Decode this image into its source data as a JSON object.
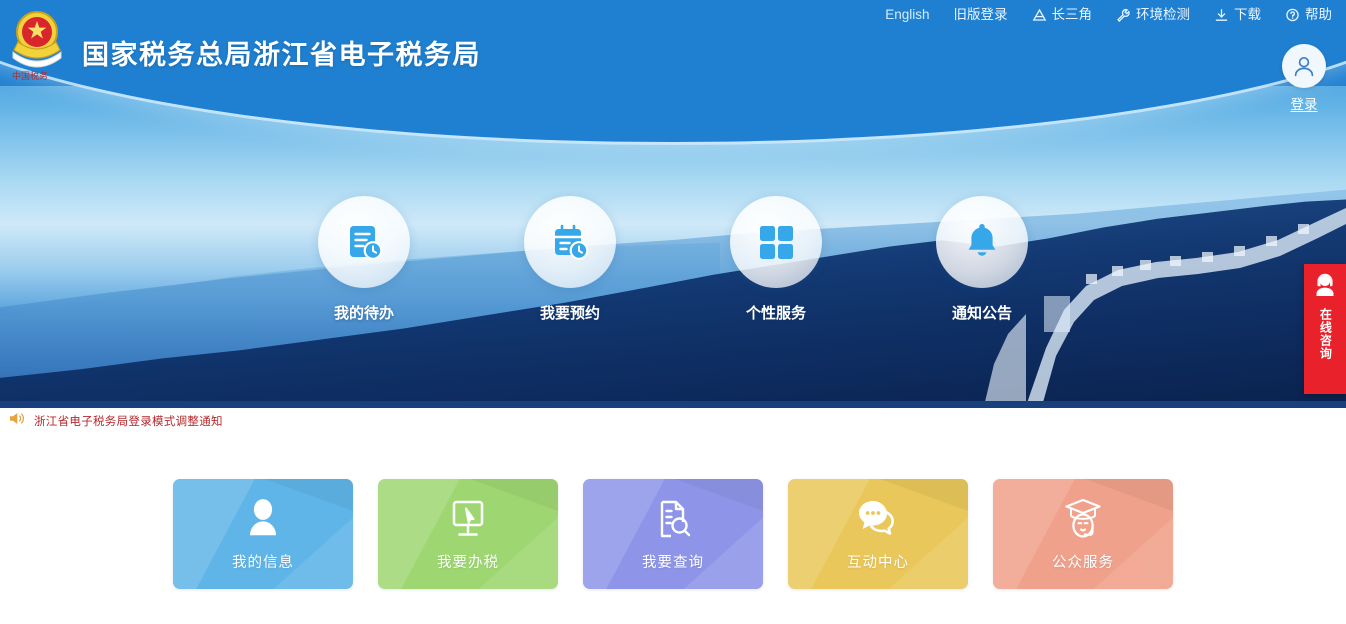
{
  "site": {
    "title": "国家税务总局浙江省电子税务局",
    "emblem_icon": "china-tax-emblem-icon",
    "brand_color": "#1f80d1"
  },
  "topnav": {
    "items": [
      {
        "label": "English",
        "icon": "none"
      },
      {
        "label": "旧版登录",
        "icon": "none"
      },
      {
        "label": "长三角",
        "icon": "triangle-icon"
      },
      {
        "label": "环境检测",
        "icon": "wrench-icon"
      },
      {
        "label": "下载",
        "icon": "download-icon"
      },
      {
        "label": "帮助",
        "icon": "question-circle-icon"
      }
    ]
  },
  "login": {
    "label": "登录",
    "avatar_icon": "user-avatar-icon"
  },
  "banner": {
    "quick_entries": [
      {
        "label": "我的待办",
        "icon": "document-clock-icon"
      },
      {
        "label": "我要预约",
        "icon": "calendar-clock-icon"
      },
      {
        "label": "个性服务",
        "icon": "grid-squares-icon"
      },
      {
        "label": "通知公告",
        "icon": "bell-icon"
      }
    ]
  },
  "consult": {
    "label": "在线咨询",
    "icon": "headset-agent-icon",
    "color": "#e8212a"
  },
  "notice": {
    "icon": "speaker-icon",
    "text": "浙江省电子税务局登录模式调整通知",
    "color": "#b3282d"
  },
  "service_cards": [
    {
      "label": "我的信息",
      "icon": "person-icon",
      "color": "#5fb5e8"
    },
    {
      "label": "我要办税",
      "icon": "monitor-cursor-icon",
      "color": "#9ed772"
    },
    {
      "label": "我要查询",
      "icon": "document-search-icon",
      "color": "#8e95e8"
    },
    {
      "label": "互动中心",
      "icon": "chat-bubbles-icon",
      "color": "#e9c75a"
    },
    {
      "label": "公众服务",
      "icon": "graduate-agent-icon",
      "color": "#f0a18b"
    }
  ]
}
